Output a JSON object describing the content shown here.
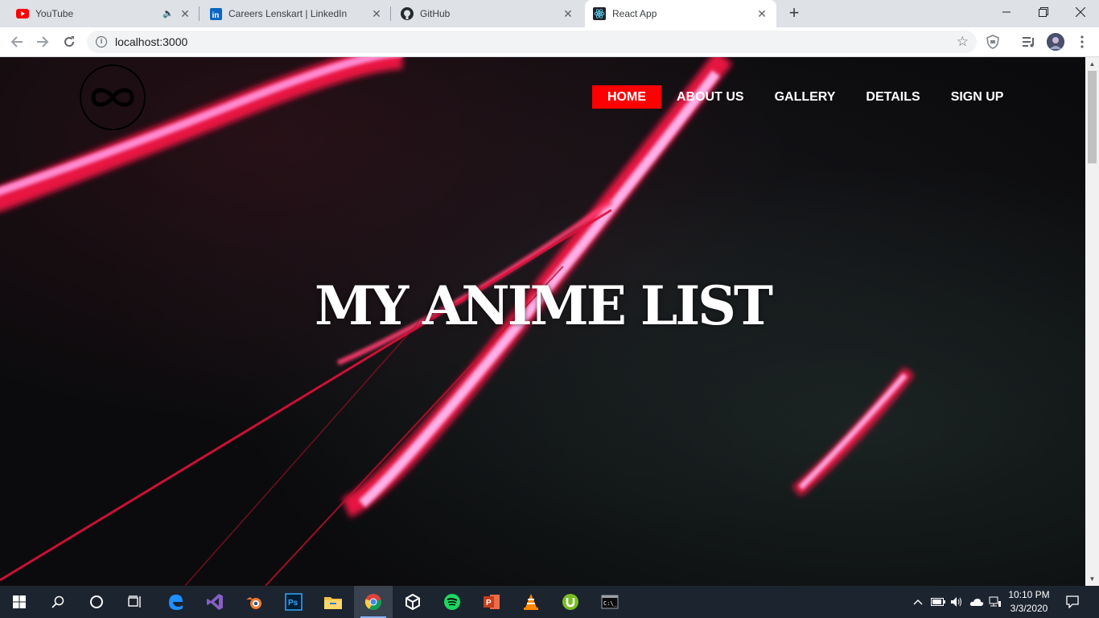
{
  "browser": {
    "tabs": [
      {
        "title": "YouTube",
        "icon": "youtube-icon",
        "audio": true
      },
      {
        "title": "Careers Lenskart | LinkedIn",
        "icon": "linkedin-icon"
      },
      {
        "title": "GitHub",
        "icon": "github-icon"
      },
      {
        "title": "React App",
        "icon": "react-icon",
        "active": true
      }
    ],
    "url": "localhost:3000"
  },
  "page": {
    "nav": [
      "HOME",
      "ABOUT US",
      "GALLERY",
      "DETAILS",
      "SIGN UP"
    ],
    "active_nav": "HOME",
    "hero_title": "MY ANIME LIST",
    "accent": "#ff0000"
  },
  "taskbar": {
    "apps": [
      "start-icon",
      "search-icon",
      "cortana-icon",
      "task-view-icon",
      "edge-icon",
      "visual-studio-icon",
      "blender-icon",
      "photoshop-icon",
      "file-explorer-icon",
      "chrome-icon",
      "unity-icon",
      "spotify-icon",
      "powerpoint-icon",
      "vlc-icon",
      "utorrent-icon",
      "terminal-icon"
    ],
    "time": "10:10 PM",
    "date": "3/3/2020"
  }
}
